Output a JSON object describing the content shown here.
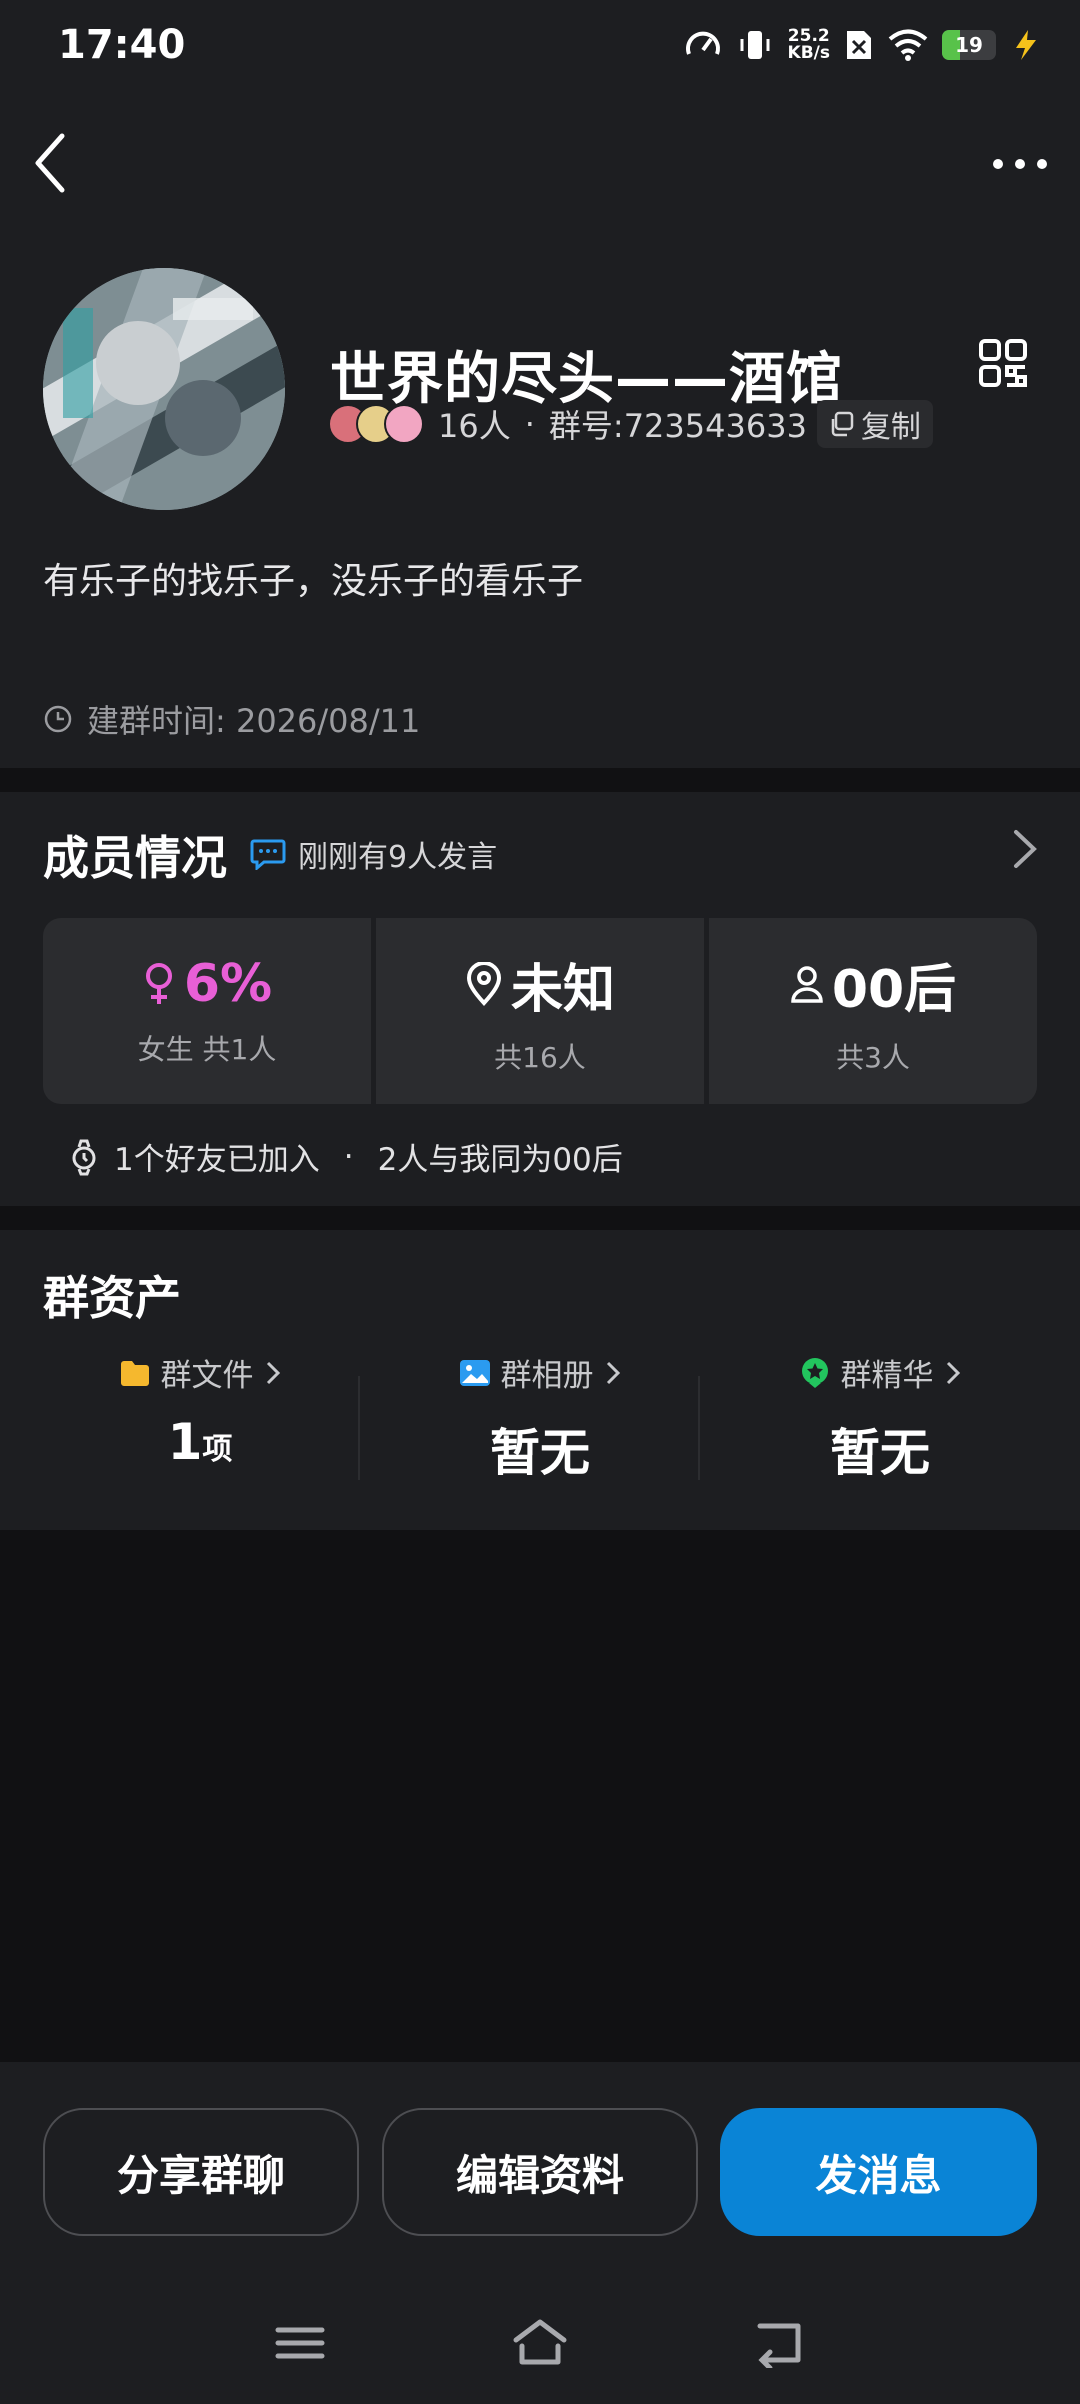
{
  "status_bar": {
    "time": "17:40",
    "net_speed_value": "25.2",
    "net_speed_unit": "KB/s",
    "battery": "19"
  },
  "group": {
    "name": "世界的尽头——酒馆",
    "member_count": "16人",
    "separator": "·",
    "group_id": "群号:723543633",
    "copy_label": "复制",
    "description": "有乐子的找乐子，没乐子的看乐子",
    "created": "建群时间: 2026/08/11"
  },
  "members": {
    "title": "成员情况",
    "recent_speak": "刚刚有9人发言",
    "stats": [
      {
        "value": "6%",
        "label": "女生 共1人",
        "icon": "female-icon"
      },
      {
        "value": "未知",
        "label": "共16人",
        "icon": "location-icon"
      },
      {
        "value": "00后",
        "label": "共3人",
        "icon": "person-icon"
      }
    ],
    "friend_joined": "1个好友已加入",
    "dot": "·",
    "same_age": "2人与我同为00后"
  },
  "assets": {
    "title": "群资产",
    "items": [
      {
        "label": "群文件",
        "value": "1",
        "unit": "项",
        "icon": "folder-icon"
      },
      {
        "label": "群相册",
        "value": "暂无",
        "unit": "",
        "icon": "photo-icon"
      },
      {
        "label": "群精华",
        "value": "暂无",
        "unit": "",
        "icon": "star-icon"
      }
    ]
  },
  "actions": {
    "share": "分享群聊",
    "edit": "编辑资料",
    "send": "发消息"
  },
  "colors": {
    "accent_blue": "#0a84d6",
    "female_pink": "#e85fd6",
    "folder_yellow": "#f5b82e",
    "photo_blue": "#2b9bf0",
    "star_green": "#22c55e"
  }
}
